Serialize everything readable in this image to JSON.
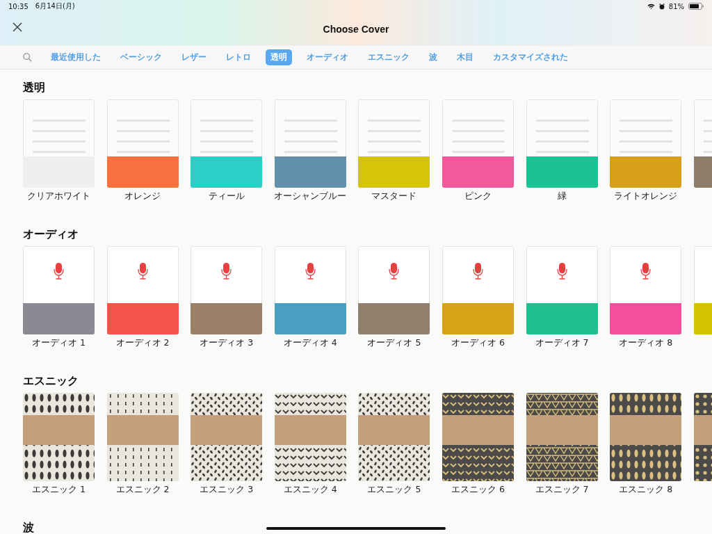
{
  "status_bar": {
    "time": "10:35",
    "date": "6月14日(月)",
    "battery": "81%"
  },
  "header": {
    "title": "Choose Cover"
  },
  "tabs": [
    {
      "label": "最近使用した",
      "selected": false
    },
    {
      "label": "ベーシック",
      "selected": false
    },
    {
      "label": "レザー",
      "selected": false
    },
    {
      "label": "レトロ",
      "selected": false
    },
    {
      "label": "透明",
      "selected": true
    },
    {
      "label": "オーディオ",
      "selected": false
    },
    {
      "label": "エスニック",
      "selected": false
    },
    {
      "label": "波",
      "selected": false
    },
    {
      "label": "木目",
      "selected": false
    },
    {
      "label": "カスタマイズされた",
      "selected": false
    }
  ],
  "sections": [
    {
      "title": "透明",
      "kind": "lined",
      "covers": [
        {
          "label": "クリアホワイト",
          "color": "#efefef"
        },
        {
          "label": "オレンジ",
          "color": "#f8703e"
        },
        {
          "label": "ティール",
          "color": "#2ccfc6"
        },
        {
          "label": "オーシャンブルー",
          "color": "#6390ad"
        },
        {
          "label": "マスタード",
          "color": "#d4c50a"
        },
        {
          "label": "ピンク",
          "color": "#f2589c"
        },
        {
          "label": "緑",
          "color": "#1bc293"
        },
        {
          "label": "ライトオレンジ",
          "color": "#d89e1c"
        },
        {
          "color": "#8e7d6b"
        }
      ]
    },
    {
      "title": "オーディオ",
      "kind": "audio",
      "covers": [
        {
          "label": "オーディオ 1",
          "color": "#8a8a92"
        },
        {
          "label": "オーディオ 2",
          "color": "#f4544a"
        },
        {
          "label": "オーディオ 3",
          "color": "#9a8068"
        },
        {
          "label": "オーディオ 4",
          "color": "#4a9fc0"
        },
        {
          "label": "オーディオ 5",
          "color": "#8f7f6c"
        },
        {
          "label": "オーディオ 6",
          "color": "#d4a317"
        },
        {
          "label": "オーディオ 7",
          "color": "#1fbf8f"
        },
        {
          "label": "オーディオ 8",
          "color": "#f2509a"
        },
        {
          "color": "#d4c400"
        }
      ]
    },
    {
      "title": "エスニック",
      "kind": "patterned",
      "covers": [
        {
          "label": "エスニック 1",
          "color": "#e9e6de",
          "kind": "ovals"
        },
        {
          "label": "エスニック 2",
          "color": "#e9e6de",
          "kind": "dashes"
        },
        {
          "label": "エスニック 3",
          "color": "#e9e6de",
          "kind": "seeds"
        },
        {
          "label": "エスニック 4",
          "color": "#e9e6de",
          "kind": "chevrons"
        },
        {
          "label": "エスニック 5",
          "color": "#e9e6de",
          "kind": "seeds"
        },
        {
          "label": "エスニック 6",
          "color": "#4b4a48",
          "kind": "chevrons"
        },
        {
          "label": "エスニック 7",
          "color": "#4b4a48",
          "kind": "triangles"
        },
        {
          "label": "エスニック 8",
          "color": "#4b4a48",
          "kind": "ovals"
        },
        {
          "color": "#4b4a48",
          "kind": "dots"
        }
      ]
    },
    {
      "title": "波"
    }
  ]
}
